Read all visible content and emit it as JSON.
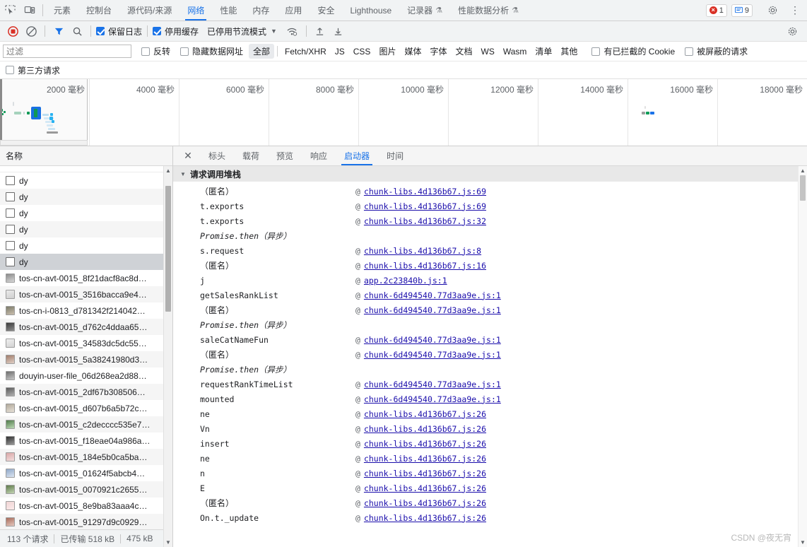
{
  "tabbar": {
    "inspect_icon": "inspect-cursor-icon",
    "device_icon": "device-toolbar-icon",
    "tabs": [
      {
        "label": "元素",
        "active": false,
        "flask": false
      },
      {
        "label": "控制台",
        "active": false,
        "flask": false
      },
      {
        "label": "源代码/来源",
        "active": false,
        "flask": false
      },
      {
        "label": "网络",
        "active": true,
        "flask": false
      },
      {
        "label": "性能",
        "active": false,
        "flask": false
      },
      {
        "label": "内存",
        "active": false,
        "flask": false
      },
      {
        "label": "应用",
        "active": false,
        "flask": false
      },
      {
        "label": "安全",
        "active": false,
        "flask": false
      },
      {
        "label": "Lighthouse",
        "active": false,
        "flask": false
      },
      {
        "label": "记录器",
        "active": false,
        "flask": true
      },
      {
        "label": "性能数据分析",
        "active": false,
        "flask": true
      }
    ],
    "error_count": "1",
    "warning_count": "9",
    "settings_icon": "gear-icon",
    "more_icon": "kebab-menu-icon"
  },
  "nettoolbar": {
    "record_icon": "record-stop-icon",
    "clear_icon": "clear-slash-icon",
    "filter_icon": "filter-funnel-icon",
    "search_icon": "search-magnifier-icon",
    "preserve_log": {
      "label": "保留日志",
      "checked": true
    },
    "disable_cache": {
      "label": "停用缓存",
      "checked": true
    },
    "throttle_label": "已停用节流模式",
    "wifi_icon": "network-conditions-icon",
    "import_icon": "import-har-icon",
    "export_icon": "export-har-icon",
    "settings_icon": "network-settings-gear-icon"
  },
  "filterbar": {
    "placeholder": "过滤",
    "value": "",
    "invert": {
      "label": "反转",
      "checked": false
    },
    "hide_data_urls": {
      "label": "隐藏数据网址",
      "checked": false
    },
    "types": [
      "全部",
      "Fetch/XHR",
      "JS",
      "CSS",
      "图片",
      "媒体",
      "字体",
      "文档",
      "WS",
      "Wasm",
      "清单",
      "其他"
    ],
    "selected_type": "全部",
    "blocked_cookies": {
      "label": "有已拦截的 Cookie",
      "checked": false
    },
    "blocked_requests": {
      "label": "被屏蔽的请求",
      "checked": false
    },
    "third_party": {
      "label": "第三方请求",
      "checked": false
    }
  },
  "overview": {
    "time_labels": [
      "2000 毫秒",
      "4000 毫秒",
      "6000 毫秒",
      "8000 毫秒",
      "10000 毫秒",
      "12000 毫秒",
      "14000 毫秒",
      "16000 毫秒",
      "18000 毫秒"
    ]
  },
  "request_list": {
    "column_header": "名称",
    "rows": [
      {
        "name": "dy",
        "type": "doc",
        "selected": false
      },
      {
        "name": "dy",
        "type": "doc",
        "selected": false
      },
      {
        "name": "dy",
        "type": "doc",
        "selected": false
      },
      {
        "name": "dy",
        "type": "doc",
        "selected": false
      },
      {
        "name": "dy",
        "type": "doc",
        "selected": false
      },
      {
        "name": "dy",
        "type": "doc",
        "selected": true
      },
      {
        "name": "tos-cn-avt-0015_8f21dacf8ac8d…",
        "type": "img",
        "selected": false
      },
      {
        "name": "tos-cn-avt-0015_3516bacca9e4…",
        "type": "img",
        "selected": false
      },
      {
        "name": "tos-cn-i-0813_d781342f214042…",
        "type": "img",
        "selected": false
      },
      {
        "name": "tos-cn-avt-0015_d762c4ddaa65…",
        "type": "img",
        "selected": false
      },
      {
        "name": "tos-cn-avt-0015_34583dc5dc55…",
        "type": "img",
        "selected": false
      },
      {
        "name": "tos-cn-avt-0015_5a38241980d3…",
        "type": "img",
        "selected": false
      },
      {
        "name": "douyin-user-file_06d268ea2d88…",
        "type": "img",
        "selected": false
      },
      {
        "name": "tos-cn-avt-0015_2df67b308506…",
        "type": "img",
        "selected": false
      },
      {
        "name": "tos-cn-avt-0015_d607b6a5b72c…",
        "type": "img",
        "selected": false
      },
      {
        "name": "tos-cn-avt-0015_c2decccc535e7…",
        "type": "img",
        "selected": false
      },
      {
        "name": "tos-cn-avt-0015_f18eae04a986a…",
        "type": "img",
        "selected": false
      },
      {
        "name": "tos-cn-avt-0015_184e5b0ca5ba…",
        "type": "img",
        "selected": false
      },
      {
        "name": "tos-cn-avt-0015_01624f5abcb4…",
        "type": "img",
        "selected": false
      },
      {
        "name": "tos-cn-avt-0015_0070921c2655…",
        "type": "img",
        "selected": false
      },
      {
        "name": "tos-cn-avt-0015_8e9ba83aaa4c…",
        "type": "img",
        "selected": false
      },
      {
        "name": "tos-cn-avt-0015_91297d9c0929…",
        "type": "img",
        "selected": false
      }
    ]
  },
  "statusbar": {
    "requests": "113 个请求",
    "transferred": "已传输 518 kB",
    "resources": "475 kB"
  },
  "detail": {
    "close_icon": "close-x-icon",
    "tabs": [
      {
        "label": "标头",
        "active": false
      },
      {
        "label": "载荷",
        "active": false
      },
      {
        "label": "预览",
        "active": false
      },
      {
        "label": "响应",
        "active": false
      },
      {
        "label": "启动器",
        "active": true
      },
      {
        "label": "时间",
        "active": false
      }
    ],
    "section_title": "请求调用堆栈",
    "at_symbol": "@",
    "stack": [
      {
        "fn": "（匿名）",
        "cn": true,
        "async": false,
        "link": "chunk-libs.4d136b67.js:69"
      },
      {
        "fn": "t.exports",
        "cn": false,
        "async": false,
        "link": "chunk-libs.4d136b67.js:69"
      },
      {
        "fn": "t.exports",
        "cn": false,
        "async": false,
        "link": "chunk-libs.4d136b67.js:32"
      },
      {
        "fn": "Promise.then（异步）",
        "cn": false,
        "async": true,
        "link": ""
      },
      {
        "fn": "s.request",
        "cn": false,
        "async": false,
        "link": "chunk-libs.4d136b67.js:8"
      },
      {
        "fn": "（匿名）",
        "cn": true,
        "async": false,
        "link": "chunk-libs.4d136b67.js:16"
      },
      {
        "fn": "j",
        "cn": false,
        "async": false,
        "link": "app.2c23840b.js:1"
      },
      {
        "fn": "getSalesRankList",
        "cn": false,
        "async": false,
        "link": "chunk-6d494540.77d3aa9e.js:1"
      },
      {
        "fn": "（匿名）",
        "cn": true,
        "async": false,
        "link": "chunk-6d494540.77d3aa9e.js:1"
      },
      {
        "fn": "Promise.then（异步）",
        "cn": false,
        "async": true,
        "link": ""
      },
      {
        "fn": "saleCatNameFun",
        "cn": false,
        "async": false,
        "link": "chunk-6d494540.77d3aa9e.js:1"
      },
      {
        "fn": "（匿名）",
        "cn": true,
        "async": false,
        "link": "chunk-6d494540.77d3aa9e.js:1"
      },
      {
        "fn": "Promise.then（异步）",
        "cn": false,
        "async": true,
        "link": ""
      },
      {
        "fn": "requestRankTimeList",
        "cn": false,
        "async": false,
        "link": "chunk-6d494540.77d3aa9e.js:1"
      },
      {
        "fn": "mounted",
        "cn": false,
        "async": false,
        "link": "chunk-6d494540.77d3aa9e.js:1"
      },
      {
        "fn": "ne",
        "cn": false,
        "async": false,
        "link": "chunk-libs.4d136b67.js:26"
      },
      {
        "fn": "Vn",
        "cn": false,
        "async": false,
        "link": "chunk-libs.4d136b67.js:26"
      },
      {
        "fn": "insert",
        "cn": false,
        "async": false,
        "link": "chunk-libs.4d136b67.js:26"
      },
      {
        "fn": "ne",
        "cn": false,
        "async": false,
        "link": "chunk-libs.4d136b67.js:26"
      },
      {
        "fn": "n",
        "cn": false,
        "async": false,
        "link": "chunk-libs.4d136b67.js:26"
      },
      {
        "fn": "E",
        "cn": false,
        "async": false,
        "link": "chunk-libs.4d136b67.js:26"
      },
      {
        "fn": "（匿名）",
        "cn": true,
        "async": false,
        "link": "chunk-libs.4d136b67.js:26"
      },
      {
        "fn": "On.t._update",
        "cn": false,
        "async": false,
        "link": "chunk-libs.4d136b67.js:26"
      }
    ]
  },
  "watermark": "CSDN @夜无宵"
}
